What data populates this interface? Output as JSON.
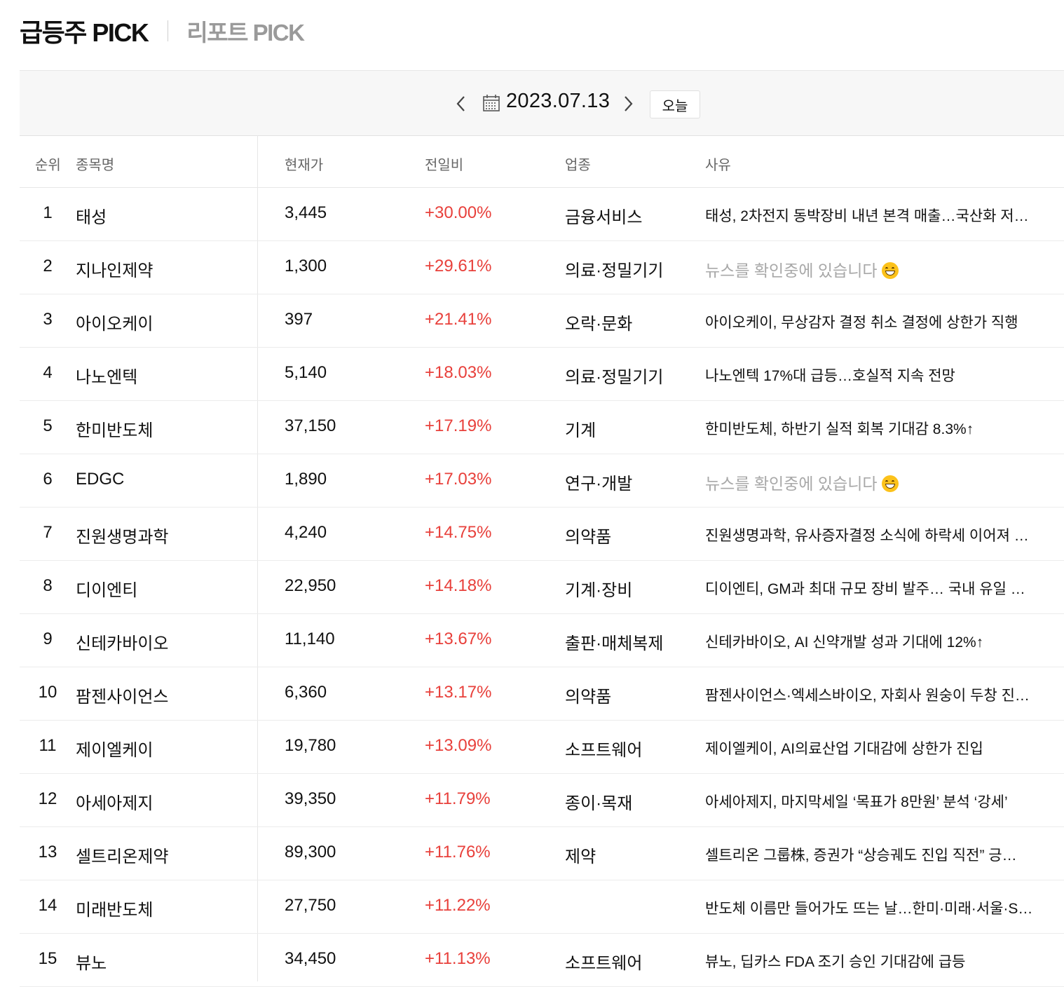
{
  "tabs": {
    "active": "급등주 PICK",
    "inactive": "리포트 PICK"
  },
  "datebar": {
    "date": "2023.07.13",
    "today_label": "오늘"
  },
  "table": {
    "headers": {
      "rank": "순위",
      "name": "종목명",
      "price": "현재가",
      "change": "전일비",
      "sector": "업종",
      "reason": "사유"
    },
    "rows": [
      {
        "rank": "1",
        "name": "태성",
        "price": "3,445",
        "change": "+30.00%",
        "sector": "금융서비스",
        "reason": "태성, 2차전지 동박장비 내년 본격 매출…국산화 저…",
        "pending": false
      },
      {
        "rank": "2",
        "name": "지나인제약",
        "price": "1,300",
        "change": "+29.61%",
        "sector": "의료·정밀기기",
        "reason": "뉴스를 확인중에 있습니다",
        "pending": true
      },
      {
        "rank": "3",
        "name": "아이오케이",
        "price": "397",
        "change": "+21.41%",
        "sector": "오락·문화",
        "reason": "아이오케이, 무상감자 결정 취소 결정에 상한가 직행",
        "pending": false
      },
      {
        "rank": "4",
        "name": "나노엔텍",
        "price": "5,140",
        "change": "+18.03%",
        "sector": "의료·정밀기기",
        "reason": "나노엔텍 17%대 급등…호실적 지속 전망",
        "pending": false
      },
      {
        "rank": "5",
        "name": "한미반도체",
        "price": "37,150",
        "change": "+17.19%",
        "sector": "기계",
        "reason": "한미반도체, 하반기 실적 회복 기대감 8.3%↑",
        "pending": false
      },
      {
        "rank": "6",
        "name": "EDGC",
        "price": "1,890",
        "change": "+17.03%",
        "sector": "연구·개발",
        "reason": "뉴스를 확인중에 있습니다",
        "pending": true
      },
      {
        "rank": "7",
        "name": "진원생명과학",
        "price": "4,240",
        "change": "+14.75%",
        "sector": "의약품",
        "reason": "진원생명과학, 유사증자결정 소식에 하락세 이어져 …",
        "pending": false
      },
      {
        "rank": "8",
        "name": "디이엔티",
        "price": "22,950",
        "change": "+14.18%",
        "sector": "기계·장비",
        "reason": "디이엔티, GM과 최대 규모 장비 발주… 국내 유일 …",
        "pending": false
      },
      {
        "rank": "9",
        "name": "신테카바이오",
        "price": "11,140",
        "change": "+13.67%",
        "sector": "출판·매체복제",
        "reason": "신테카바이오, AI 신약개발 성과 기대에 12%↑",
        "pending": false
      },
      {
        "rank": "10",
        "name": "팜젠사이언스",
        "price": "6,360",
        "change": "+13.17%",
        "sector": "의약품",
        "reason": "팜젠사이언스·엑세스바이오, 자회사 원숭이 두창 진…",
        "pending": false
      },
      {
        "rank": "11",
        "name": "제이엘케이",
        "price": "19,780",
        "change": "+13.09%",
        "sector": "소프트웨어",
        "reason": "제이엘케이, AI의료산업 기대감에 상한가 진입",
        "pending": false
      },
      {
        "rank": "12",
        "name": "아세아제지",
        "price": "39,350",
        "change": "+11.79%",
        "sector": "종이·목재",
        "reason": "아세아제지, 마지막세일 ‘목표가 8만원’ 분석 ‘강세’",
        "pending": false
      },
      {
        "rank": "13",
        "name": "셀트리온제약",
        "price": "89,300",
        "change": "+11.76%",
        "sector": "제약",
        "reason": "셀트리온 그룹株, 증권가 “상승궤도 진입 직전” 긍…",
        "pending": false
      },
      {
        "rank": "14",
        "name": "미래반도체",
        "price": "27,750",
        "change": "+11.22%",
        "sector": "",
        "reason": "반도체 이름만 들어가도 뜨는 날…한미·미래·서울·S…",
        "pending": false
      },
      {
        "rank": "15",
        "name": "뷰노",
        "price": "34,450",
        "change": "+11.13%",
        "sector": "소프트웨어",
        "reason": "뷰노, 딥카스 FDA 조기 승인 기대감에 급등",
        "pending": false
      }
    ]
  },
  "colors": {
    "up": "#e8403b",
    "pending": "#a8a8a8",
    "datebar_bg": "#f7f7f7"
  },
  "icons": {
    "prev": "chevron-left-icon",
    "calendar": "calendar-icon",
    "next": "chevron-right-icon",
    "emoji": "grinning-face-icon"
  }
}
